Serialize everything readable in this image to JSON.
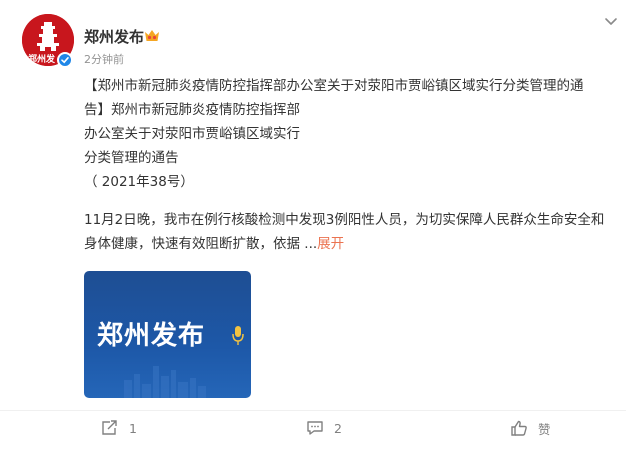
{
  "user": {
    "name": "郑州发布",
    "avatar_text": "郑州发",
    "time": "2分钟前"
  },
  "post": {
    "lines": [
      "【郑州市新冠肺炎疫情防控指挥部办公室关于对荥阳市贾峪镇区域实行分类管理的通",
      "告】郑州市新冠肺炎疫情防控指挥部",
      "办公室关于对荥阳市贾峪镇区域实行",
      "分类管理的通告",
      "（ 2021年38号）"
    ],
    "para2_line1": "11月2日晚，我市在例行核酸检测中发现3例阳性人员，为切实保障人民群众生命安全和",
    "para2_line2": "身体健康，快速有效阻断扩散，依据  ...",
    "expand_label": "展开"
  },
  "image": {
    "logo_text": "郑州发布"
  },
  "footer": {
    "repost_count": "1",
    "comment_count": "2",
    "like_label": "赞"
  },
  "colors": {
    "accent": "#eb7350",
    "brand_red": "#c8161d",
    "verified_blue": "#1f87e8",
    "image_blue": "#1d58a8"
  },
  "icons": [
    "chevron-down-icon",
    "verified-icon",
    "vip-badge-icon",
    "repost-icon",
    "comment-icon",
    "like-icon",
    "mic-icon"
  ]
}
